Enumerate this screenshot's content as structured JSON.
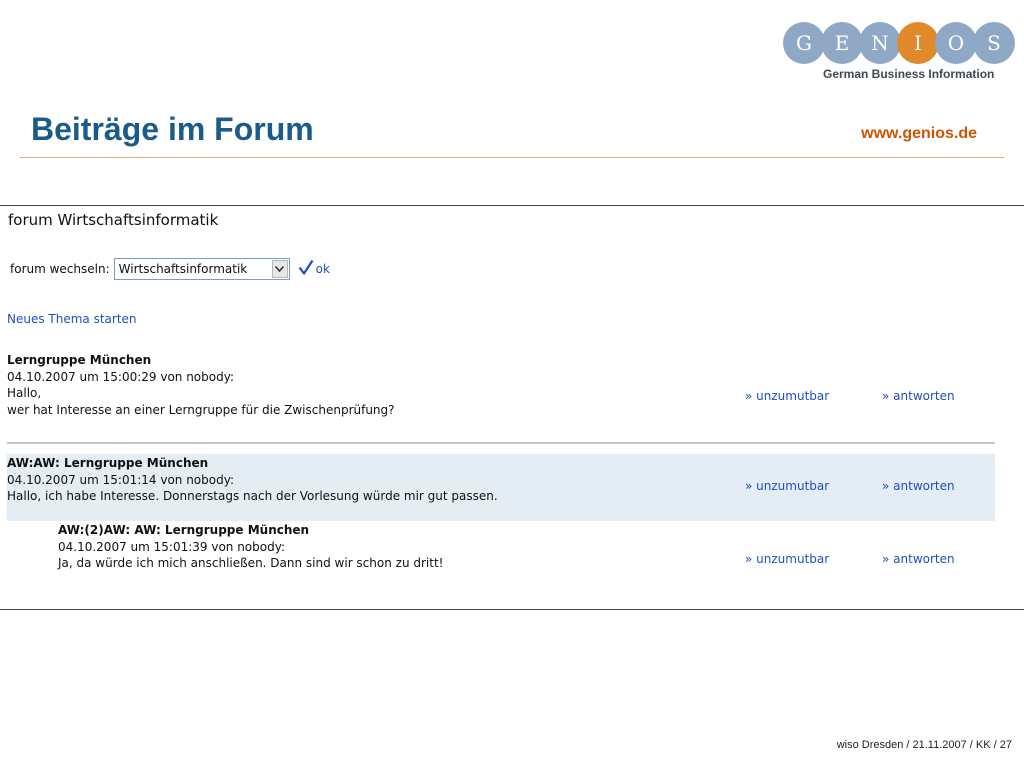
{
  "slide": {
    "title": "Beiträge im Forum",
    "url": "www.genios.de",
    "footer": "wiso Dresden / 21.11.2007 / KK / 27"
  },
  "logo": {
    "letters": [
      "G",
      "E",
      "N",
      "I",
      "O",
      "S"
    ],
    "tagline": "German Business Information",
    "colors": {
      "blue": "#8fa8c6",
      "orange": "#e08a2c"
    }
  },
  "colors": {
    "title": "#1b5b8a",
    "url": "#cc5500",
    "link": "#1f4fbf",
    "highlight_row": "#e5edf4"
  },
  "forum": {
    "heading": "forum Wirtschaftsinformatik",
    "switch_label": "forum wechseln:",
    "selected_forum": "Wirtschaftsinformatik",
    "ok_label": "ok",
    "new_topic": "Neues Thema starten",
    "posts": [
      {
        "title": "Lerngruppe München",
        "meta": "04.10.2007 um 15:00:29 von nobody:",
        "lines": [
          "Hallo,",
          "wer hat Interesse an einer Lerngruppe für die Zwischenprüfung?"
        ],
        "report": "» unzumutbar",
        "reply": "» antworten"
      },
      {
        "title": "AW:AW: Lerngruppe München",
        "meta": "04.10.2007 um 15:01:14 von nobody:",
        "lines": [
          "Hallo, ich habe Interesse. Donnerstags nach der Vorlesung würde mir gut passen."
        ],
        "report": "» unzumutbar",
        "reply": "» antworten"
      },
      {
        "title": "AW:(2)AW: AW: Lerngruppe München",
        "meta": "04.10.2007 um 15:01:39 von nobody:",
        "lines": [
          "Ja, da würde ich mich anschließen. Dann sind wir schon zu dritt!"
        ],
        "report": "» unzumutbar",
        "reply": "» antworten"
      }
    ]
  }
}
